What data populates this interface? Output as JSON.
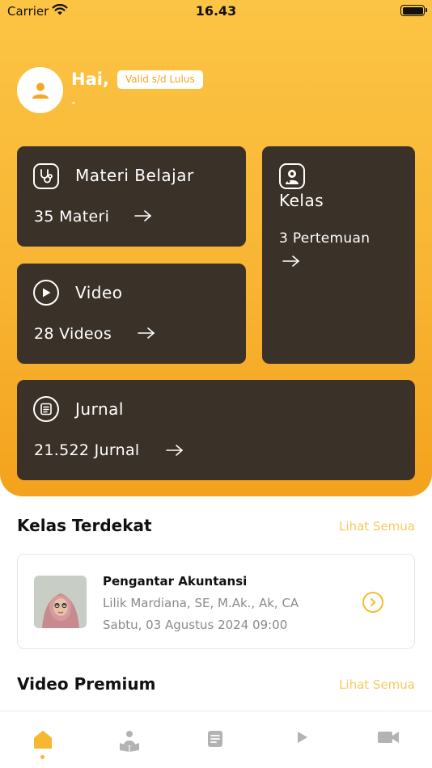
{
  "status_bar": {
    "carrier": "Carrier",
    "time": "16.43"
  },
  "header": {
    "greeting": "Hai,",
    "badge": "Valid s/d Lulus",
    "username": "-"
  },
  "cards": {
    "materi": {
      "title": "Materi Belajar",
      "count": "35 Materi",
      "icon": "stethoscope-icon"
    },
    "video": {
      "title": "Video",
      "count": "28 Videos",
      "icon": "play-icon"
    },
    "kelas": {
      "title": "Kelas",
      "count": "3 Pertemuan",
      "icon": "doctor-icon"
    },
    "jurnal": {
      "title": "Jurnal",
      "count": "21.522 Jurnal",
      "icon": "journal-icon"
    }
  },
  "kelas_terdekat": {
    "title": "Kelas Terdekat",
    "see_all": "Lihat Semua",
    "item": {
      "name": "Pengantar Akuntansi",
      "teacher": "Lilik Mardiana, SE, M.Ak., Ak, CA",
      "datetime": "Sabtu, 03 Agustus 2024  09:00"
    }
  },
  "video_premium": {
    "title": "Video Premium",
    "see_all": "Lihat Semua"
  },
  "tabbar": {
    "items": [
      "home-icon",
      "reader-icon",
      "journal-icon",
      "play-icon",
      "video-camera-icon"
    ],
    "active": "home-icon"
  },
  "colors": {
    "accent": "#f7b733",
    "card": "#3a3128",
    "link": "#f8c95c"
  }
}
